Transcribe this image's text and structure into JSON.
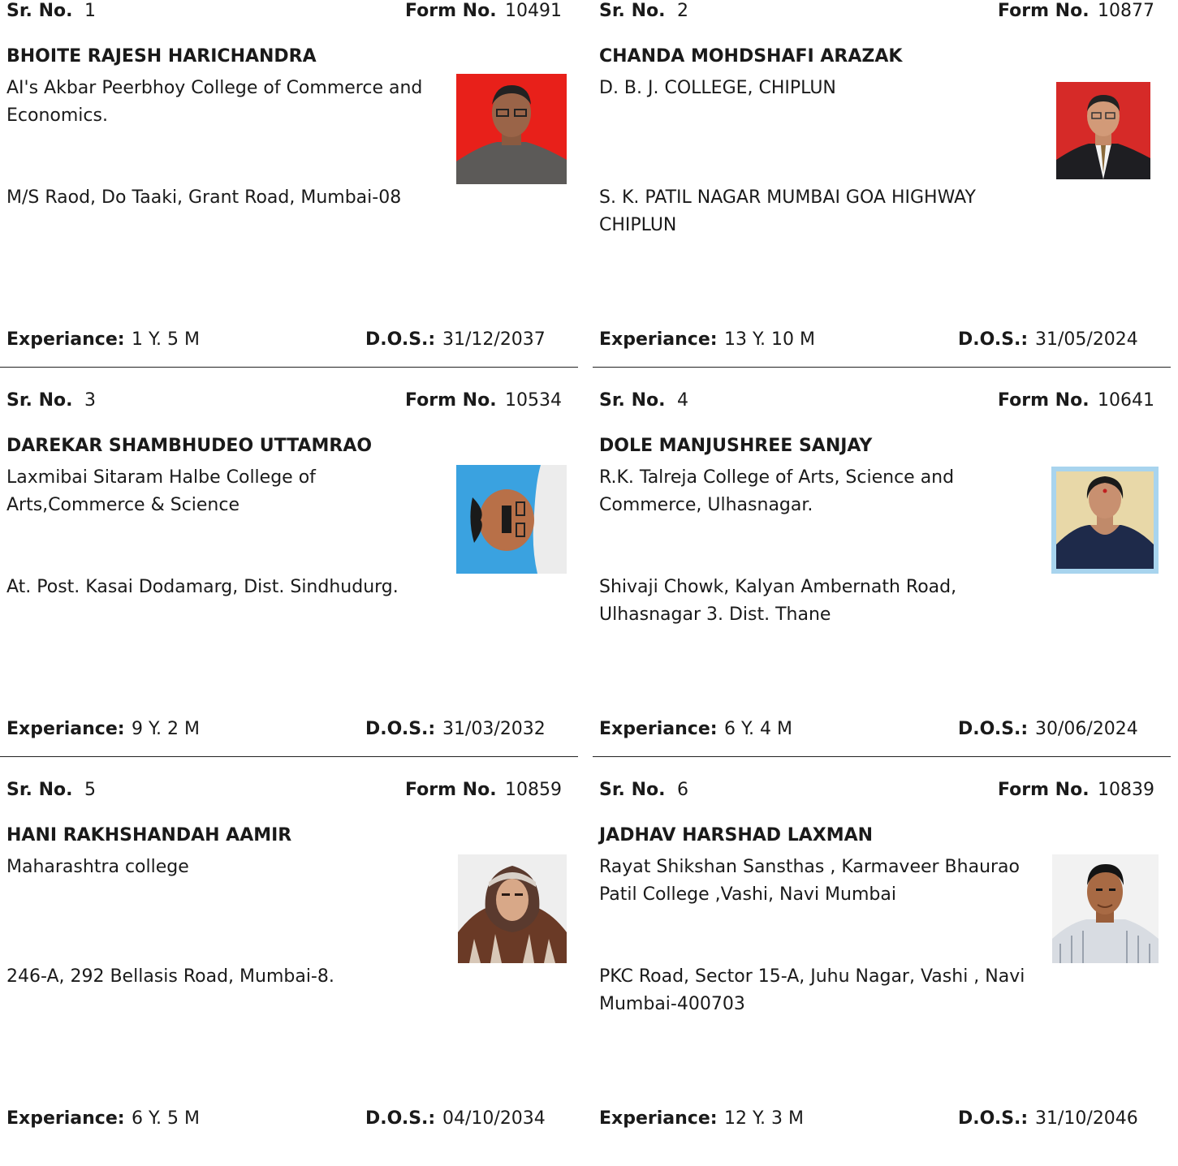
{
  "labels": {
    "sr_no": "Sr. No.",
    "form_no": "Form No.",
    "experience": "Experiance:",
    "dos": "D.O.S.:"
  },
  "records": [
    {
      "sr_no": "1",
      "form_no": "10491",
      "name": "BHOITE RAJESH HARICHANDRA",
      "college": "AI's Akbar Peerbhoy College of Commerce and Economics.",
      "address": "M/S Raod, Do Taaki, Grant Road, Mumbai-08",
      "experience": "1 Y. 5 M",
      "dos": "31/12/2037",
      "photo_background": "#e8201a"
    },
    {
      "sr_no": "2",
      "form_no": "10877",
      "name": "CHANDA MOHDSHAFI ARAZAK",
      "college": "D. B. J. COLLEGE, CHIPLUN",
      "address": "S. K. PATIL NAGAR MUMBAI GOA HIGHWAY CHIPLUN",
      "experience": "13 Y. 10 M",
      "dos": "31/05/2024",
      "photo_background": "#d62a28"
    },
    {
      "sr_no": "3",
      "form_no": "10534",
      "name": "DAREKAR SHAMBHUDEO UTTAMRAO",
      "college": "Laxmibai Sitaram Halbe  College of Arts,Commerce & Science",
      "address": "At. Post. Kasai Dodamarg, Dist. Sindhudurg.",
      "experience": "9 Y. 2 M",
      "dos": "31/03/2032",
      "photo_background": "#3aa2e0"
    },
    {
      "sr_no": "4",
      "form_no": "10641",
      "name": "DOLE MANJUSHREE SANJAY",
      "college": "R.K. Talreja College of Arts, Science and Commerce, Ulhasnagar.",
      "address": "Shivaji Chowk, Kalyan Ambernath Road, Ulhasnagar 3. Dist. Thane",
      "experience": "6 Y. 4 M",
      "dos": "30/06/2024",
      "photo_background": "#a8d4ee"
    },
    {
      "sr_no": "5",
      "form_no": "10859",
      "name": "HANI RAKHSHANDAH AAMIR",
      "college": "Maharashtra college",
      "address": "246-A, 292 Bellasis Road, Mumbai-8.",
      "experience": "6 Y. 5 M",
      "dos": "04/10/2034",
      "photo_background": "#eeeeee"
    },
    {
      "sr_no": "6",
      "form_no": "10839",
      "name": "JADHAV HARSHAD LAXMAN",
      "college": "Rayat Shikshan Sansthas , Karmaveer Bhaurao Patil College ,Vashi, Navi Mumbai",
      "address": "PKC Road, Sector 15-A, Juhu Nagar, Vashi , Navi Mumbai-400703",
      "experience": "12 Y. 3 M",
      "dos": "31/10/2046",
      "photo_background": "#f2f2f2"
    }
  ]
}
